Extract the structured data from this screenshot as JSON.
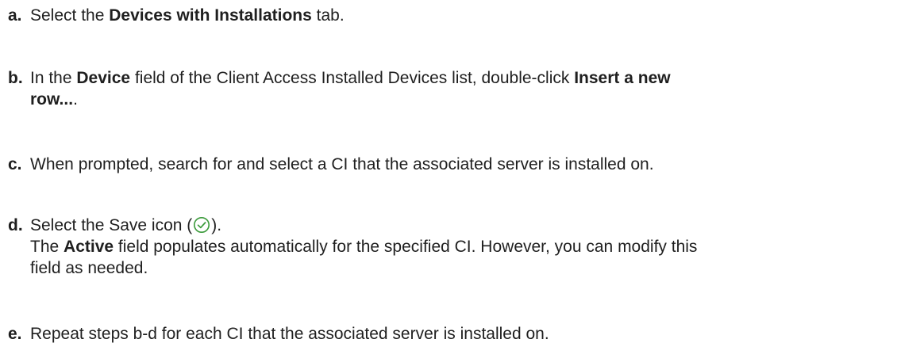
{
  "steps": [
    {
      "marker": "a.",
      "pre": "Select the ",
      "bold1": "Devices with Installations",
      "post": " tab."
    },
    {
      "marker": "b.",
      "pre": "In the ",
      "bold1": "Device",
      "mid": " field of the Client Access Installed Devices list, double-click ",
      "bold2": "Insert a new",
      "bold2_cont": "row...",
      "post": "."
    },
    {
      "marker": "c.",
      "text": "When prompted, search for and select a CI that the associated server is installed on."
    },
    {
      "marker": "d.",
      "pre": "Select the Save icon (",
      "icon": "save-check-circle-icon",
      "post": ").",
      "note_pre": "The ",
      "note_bold": "Active",
      "note_mid": " field populates automatically for the specified CI. However, you can modify this",
      "note_cont": "field as needed."
    },
    {
      "marker": "e.",
      "text": "Repeat steps b-d for each CI that the associated server is installed on."
    }
  ],
  "colors": {
    "text": "#1f1f1f",
    "save_icon": "#3a9a3a"
  }
}
